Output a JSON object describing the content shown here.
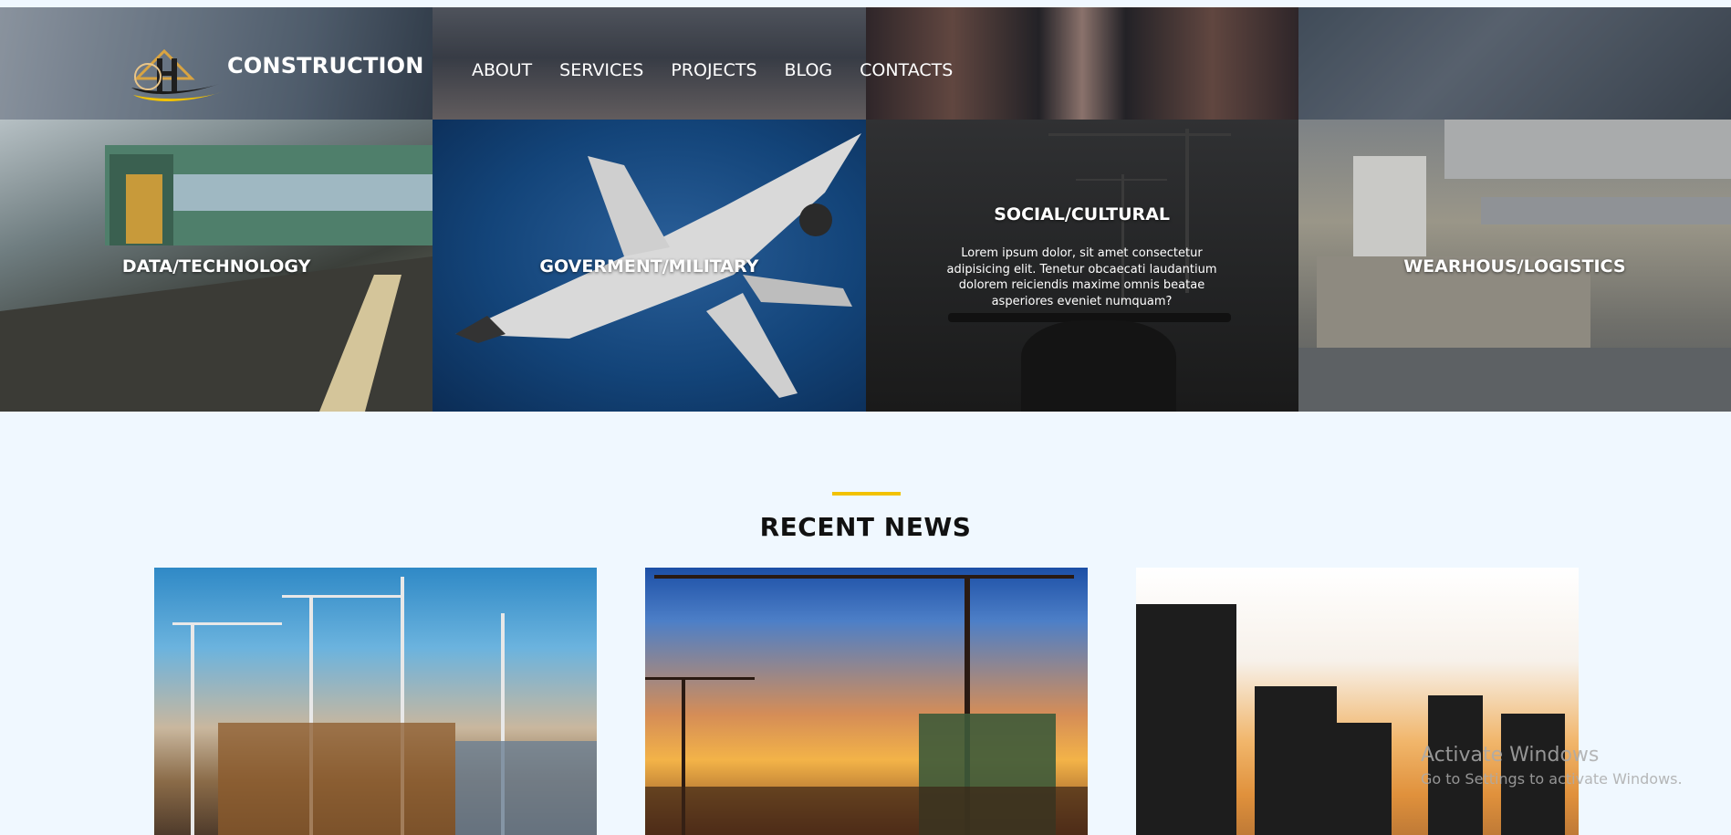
{
  "header": {
    "brand": "CONSTRUCTION",
    "nav": [
      "ABOUT",
      "SERVICES",
      "PROJECTS",
      "BLOG",
      "CONTACTS"
    ]
  },
  "categories": [
    {
      "title": "DATA/TECHNOLOGY"
    },
    {
      "title": "GOVERMENT/MILITARY"
    },
    {
      "title": "SOCIAL/CULTURAL",
      "desc_lines": [
        "Lorem ipsum dolor, sit amet consectetur",
        "adipisicing elit. Tenetur obcaecati laudantium",
        "dolorem reiciendis maxime omnis beatae",
        "asperiores eveniet numquam?"
      ]
    },
    {
      "title": "WEARHOUS/LOGISTICS"
    }
  ],
  "section": {
    "title": "RECENT NEWS"
  },
  "watermark": {
    "line1": "Activate Windows",
    "line2": "Go to Settings to activate Windows."
  },
  "colors": {
    "accent": "#f2c200",
    "page_bg": "#f0f8ff",
    "heading": "#111111"
  }
}
